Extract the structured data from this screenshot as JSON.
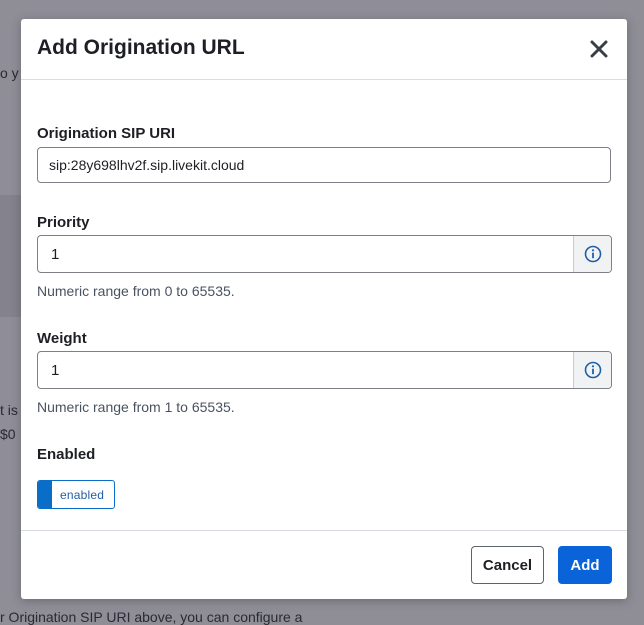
{
  "background": {
    "snippets": [
      "o y",
      "t is",
      "$0",
      "r Origination SIP URI above, you can configure a"
    ]
  },
  "modal": {
    "title": "Add Origination URL",
    "close_icon": "close-icon",
    "fields": {
      "sip_uri": {
        "label": "Origination SIP URI",
        "value": "sip:28y698lhv2f.sip.livekit.cloud"
      },
      "priority": {
        "label": "Priority",
        "value": "1",
        "help": "Numeric range from 0 to 65535.",
        "icon": "info-icon"
      },
      "weight": {
        "label": "Weight",
        "value": "1",
        "help": "Numeric range from 1 to 65535.",
        "icon": "info-icon"
      },
      "enabled": {
        "label": "Enabled",
        "toggle_text": "enabled",
        "checked": true
      }
    },
    "footer": {
      "cancel_label": "Cancel",
      "add_label": "Add"
    }
  },
  "colors": {
    "accent": "#0a63d8",
    "toggle": "#0a6ec8",
    "overlay": "#8f8e97"
  }
}
